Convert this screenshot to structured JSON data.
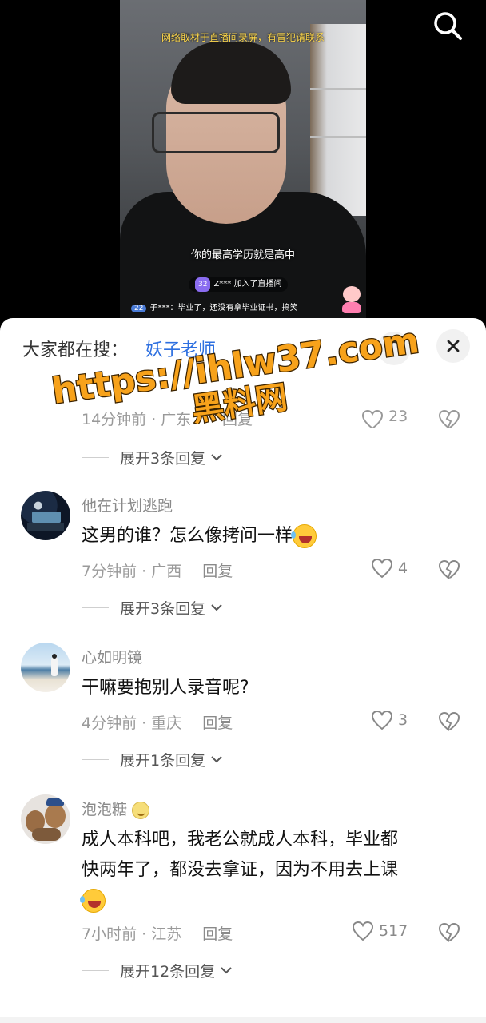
{
  "video": {
    "notice": "网络取材于直播间录屏，有冒犯请联系",
    "subtitle": "你的最高学历就是高中",
    "join_level": "32",
    "join_text": "Z*** 加入了直播间",
    "chat_level": "22",
    "chat_text": "子***：毕业了，还没有拿毕业证书，搞笑"
  },
  "search": {
    "prefix": "大家都在搜：",
    "term": "妖子老师"
  },
  "watermark": {
    "url": "https://ihlw37.com",
    "name": "黑料网"
  },
  "partial_comment": {
    "time_region": "14分钟前 · 广东",
    "reply": "回复",
    "likes": "23"
  },
  "expand_first": "展开3条回复",
  "comments": [
    {
      "username": "他在计划逃跑",
      "text": "这男的谁？怎么像拷问一样",
      "time_region": "7分钟前 · 广西",
      "reply": "回复",
      "likes": "4",
      "expand": "展开3条回复"
    },
    {
      "username": "心如明镜",
      "text": "干嘛要抱别人录音呢?",
      "time_region": "4分钟前 · 重庆",
      "reply": "回复",
      "likes": "3",
      "expand": "展开1条回复"
    },
    {
      "username": "泡泡糖",
      "text_line1": "成人本科吧，我老公就成人本科，毕业都",
      "text_line2": "快两年了，都没去拿证，因为不用去上课",
      "time_region": "7小时前 · 江苏",
      "reply": "回复",
      "likes": "517",
      "expand": "展开12条回复"
    }
  ],
  "colors": {
    "accent_blue": "#2d6fe0",
    "watermark_orange": "#f7a21b"
  }
}
